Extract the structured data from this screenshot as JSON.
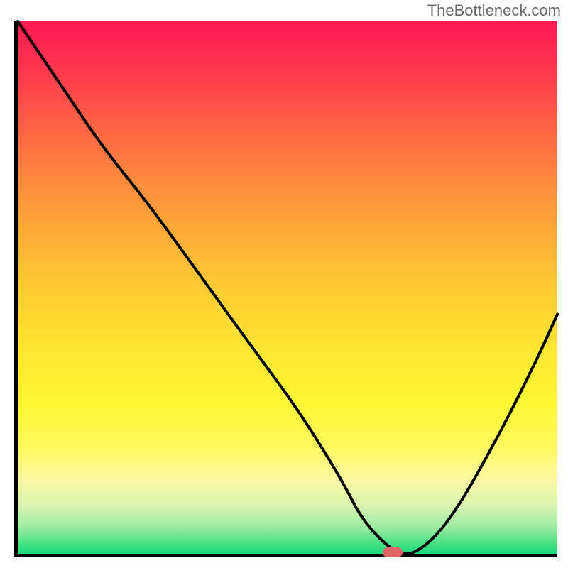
{
  "watermark": "TheBottleneck.com",
  "chart_data": {
    "type": "line",
    "title": "",
    "xlabel": "",
    "ylabel": "",
    "xlim": [
      0,
      1
    ],
    "ylim": [
      0,
      1
    ],
    "series": [
      {
        "name": "curve",
        "x": [
          0.0,
          0.08,
          0.16,
          0.24,
          0.34,
          0.44,
          0.52,
          0.6,
          0.64,
          0.7,
          0.74,
          0.8,
          0.88,
          0.96,
          1.0
        ],
        "values": [
          1.0,
          0.88,
          0.76,
          0.66,
          0.52,
          0.38,
          0.27,
          0.14,
          0.06,
          0.0,
          0.0,
          0.06,
          0.2,
          0.36,
          0.45
        ]
      }
    ],
    "marker": {
      "x": 0.695,
      "y": 0.0
    },
    "background_gradient": {
      "top": "#ff1953",
      "mid": "#ffe731",
      "bottom": "#1dd97c"
    }
  }
}
